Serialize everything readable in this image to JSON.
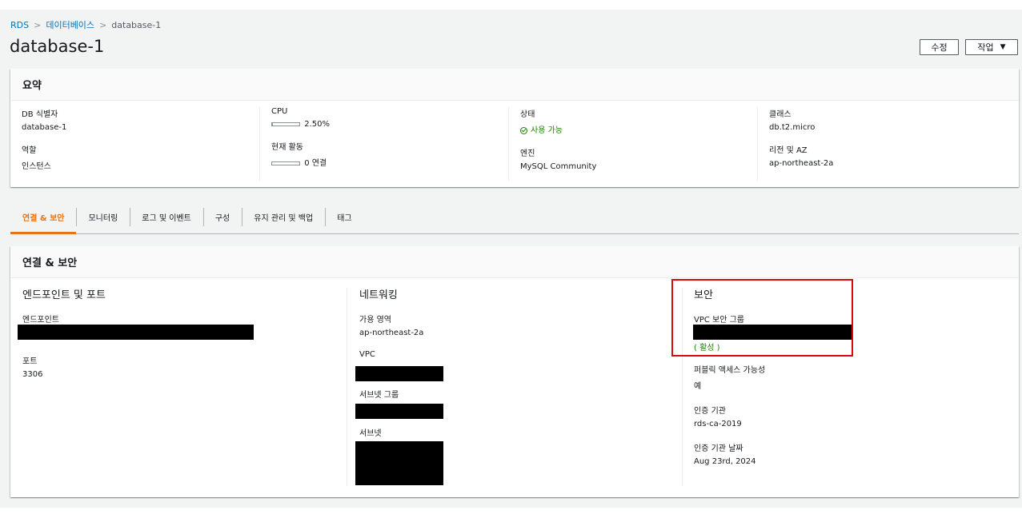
{
  "breadcrumb": {
    "root": "RDS",
    "section": "데이터베이스",
    "current": "database-1"
  },
  "page": {
    "title": "database-1"
  },
  "toolbar": {
    "modify_label": "수정",
    "actions_label": "작업",
    "actions_caret": "▼"
  },
  "summary": {
    "title": "요약",
    "db_id_label": "DB 식별자",
    "db_id_value": "database-1",
    "role_label": "역할",
    "role_value": "인스턴스",
    "cpu_label": "CPU",
    "cpu_value": "2.50%",
    "cpu_percent": 2.5,
    "activity_label": "현재 활동",
    "activity_value": "0 연결",
    "status_label": "상태",
    "status_value": "사용 가능",
    "engine_label": "엔진",
    "engine_value": "MySQL Community",
    "class_label": "클래스",
    "class_value": "db.t2.micro",
    "region_label": "리전 및 AZ",
    "region_value": "ap-northeast-2a"
  },
  "tabs": [
    "연결 & 보안",
    "모니터링",
    "로그 및 이벤트",
    "구성",
    "유지 관리 및 백업",
    "태그"
  ],
  "connectivity": {
    "title": "연결 & 보안",
    "endpoint_section": {
      "heading": "엔드포인트 및 포트",
      "endpoint_label": "엔드포인트",
      "port_label": "포트",
      "port_value": "3306"
    },
    "network_section": {
      "heading": "네트워킹",
      "az_label": "가용 영역",
      "az_value": "ap-northeast-2a",
      "vpc_label": "VPC",
      "subnet_group_label": "서브넷 그룹",
      "subnets_label": "서브넷"
    },
    "security_section": {
      "heading": "보안",
      "sg_label": "VPC 보안 그룹",
      "sg_status": "( 활성 )",
      "public_label": "퍼블릭 액세스 가능성",
      "public_value": "예",
      "ca_label": "인증 기관",
      "ca_value": "rds-ca-2019",
      "ca_date_label": "인증 기관 날짜",
      "ca_date_value": "Aug 23rd, 2024"
    }
  },
  "colors": {
    "accent": "#ec7211",
    "link": "#0073bb",
    "success": "#1d8102",
    "highlight": "#d80b0b"
  }
}
